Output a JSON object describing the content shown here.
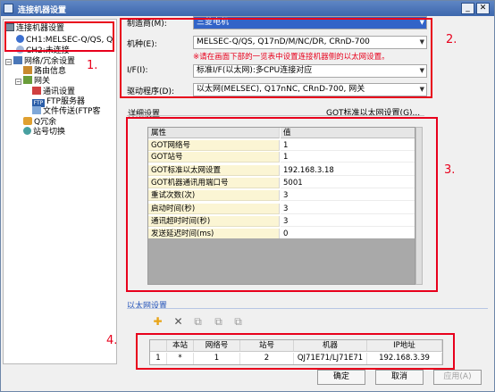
{
  "window": {
    "title": "连接机器设置",
    "min_label": "_",
    "close_label": "✕"
  },
  "tree": {
    "root": "连接机器设置",
    "ch1": "CH1:MELSEC-Q/QS, Q",
    "ch2": "CH2:未连接",
    "network": "网络/冗余设置",
    "routing": "路由信息",
    "gateway": "网关",
    "comm_settings": "通讯设置",
    "ftp_server": "FTP服务器",
    "file_transfer": "文件传送(FTP客",
    "q_redundant": "Q冗余",
    "station_switch": "站号切换",
    "ftp_badge": "FTP"
  },
  "form": {
    "manufacturer_label": "制造商(M):",
    "manufacturer_value": "三菱电机",
    "model_label": "机种(E):",
    "model_value": "MELSEC-Q/QS, Q17nD/M/NC/DR, CRnD-700",
    "note": "※请在画面下部的一览表中设置连接机器侧的以太网设置。",
    "if_label": "I/F(I):",
    "if_value": "标准I/F(以太网):多CPU连接对应",
    "driver_label": "驱动程序(D):",
    "driver_value": "以太网(MELSEC), Q17nNC, CRnD-700, 网关"
  },
  "detail": {
    "section_label": "详细设置",
    "got_link": "GOT标准以太网设置(G)...",
    "header": {
      "property": "属性",
      "value": "值"
    },
    "rows": [
      {
        "property": "GOT网络号",
        "value": "1"
      },
      {
        "property": "GOT站号",
        "value": "1"
      },
      {
        "property": "GOT标准以太网设置",
        "value": "192.168.3.18"
      },
      {
        "property": "GOT机器通讯用端口号",
        "value": "5001"
      },
      {
        "property": "重试次数(次)",
        "value": "3"
      },
      {
        "property": "启动时间(秒)",
        "value": "3"
      },
      {
        "property": "通讯超时时间(秒)",
        "value": "3"
      },
      {
        "property": "发送延迟时间(ms)",
        "value": "0"
      }
    ]
  },
  "ethernet": {
    "title": "以太网设置",
    "toolbar": {
      "add": "✚",
      "delete": "✕",
      "copy": "⧉",
      "cut": "⧉",
      "paste": "⧉"
    },
    "columns": [
      "",
      "本站",
      "网络号",
      "站号",
      "机器",
      "IP地址"
    ],
    "rows": [
      [
        "1",
        "*",
        "1",
        "2",
        "QJ71E71/LJ71E71",
        "192.168.3.39"
      ]
    ]
  },
  "annotations": [
    "1.",
    "2.",
    "3.",
    "4."
  ],
  "buttons": {
    "ok": "确定",
    "cancel": "取消",
    "apply": "应用(A)"
  },
  "colors": {
    "annotation_red": "#e8001c",
    "selection_blue": "#3264c8",
    "property_bg": "#fbf5d4"
  }
}
